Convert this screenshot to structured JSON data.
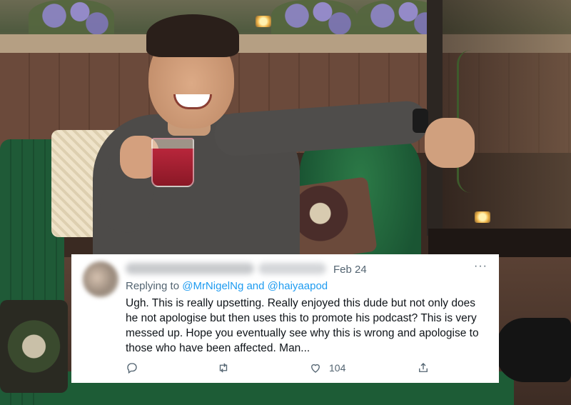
{
  "tweet": {
    "date": "Feb 24",
    "replying_prefix": "Replying to",
    "mention_1": "@MrNigelNg",
    "connector": "and",
    "mention_2": "@haiyaapod",
    "text": "Ugh. This is really upsetting. Really enjoyed this dude but not only does he not apologise but then uses this to promote his podcast? This is very messed up. Hope you eventually see why this is wrong and apologise to those who have been affected. Man...",
    "more_label": "···",
    "actions": {
      "reply_icon": "reply-icon",
      "retweet_icon": "retweet-icon",
      "like_icon": "heart-icon",
      "like_count": "104",
      "share_icon": "share-icon"
    }
  },
  "colors": {
    "link": "#1d9bf0",
    "secondary_text": "#536471",
    "primary_text": "#0f1419",
    "card_bg": "#ffffff"
  }
}
